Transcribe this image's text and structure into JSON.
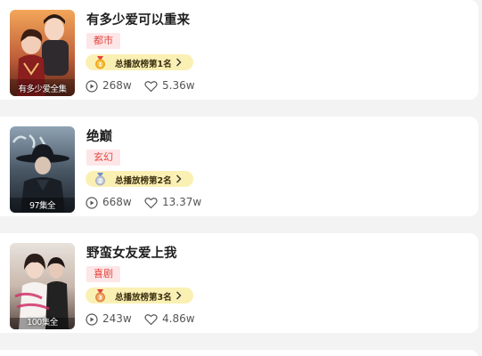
{
  "list": [
    {
      "title": "有多少爱可以重来",
      "genre": "都市",
      "rank_text": "总播放榜第1名",
      "plays": "268w",
      "likes": "5.36w",
      "poster_caption": "有多少爱全集",
      "medal_color": "#f0a81e"
    },
    {
      "title": "绝巅",
      "genre": "玄幻",
      "rank_text": "总播放榜第2名",
      "plays": "668w",
      "likes": "13.37w",
      "poster_caption": "97集全",
      "medal_color": "#aab3c4"
    },
    {
      "title": "野蛮女友爱上我",
      "genre": "喜剧",
      "rank_text": "总播放榜第3名",
      "plays": "243w",
      "likes": "4.86w",
      "poster_caption": "100集全",
      "medal_color": "#e08a45"
    }
  ],
  "colors": {
    "genre_text": "#e2453f",
    "genre_bg": "#fde6e7",
    "rank_bg": "#fbf0b4",
    "page_bg": "#f3f3f3"
  },
  "icons": {
    "plays": "play-circle-icon",
    "likes": "heart-icon",
    "rank": "medal-icon",
    "chevron": "chevron-right-icon"
  }
}
